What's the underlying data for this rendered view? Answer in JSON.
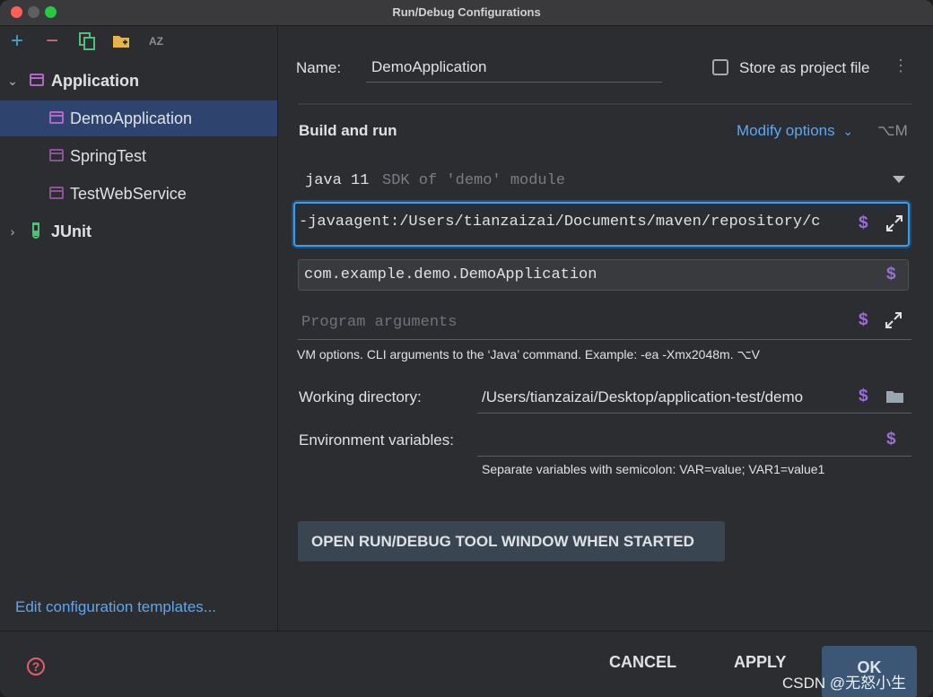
{
  "window": {
    "title": "Run/Debug Configurations"
  },
  "left": {
    "toolbar": {
      "add": "+",
      "remove": "−",
      "sort": "AZ"
    },
    "tree": [
      {
        "label": "Application",
        "expanded": true
      },
      {
        "label": "DemoApplication",
        "selected": true
      },
      {
        "label": "SpringTest"
      },
      {
        "label": "TestWebService"
      },
      {
        "label": "JUnit",
        "expanded": false
      }
    ],
    "edit_templates": "Edit configuration templates..."
  },
  "form": {
    "name_label": "Name:",
    "name_value": "DemoApplication",
    "store_label": "Store as project file",
    "build_run": "Build and run",
    "modify_options": "Modify options",
    "modify_shortcut": "⌥M",
    "sdk_java": "java 11",
    "sdk_desc": "SDK of 'demo' module",
    "vm_value": "-javaagent:/Users/tianzaizai/Documents/maven/repository/c",
    "main_class": "com.example.demo.DemoApplication",
    "program_args_placeholder": "Program arguments",
    "vm_hint": "VM options. CLI arguments to the ‘Java’ command. Example: -ea -Xmx2048m. ⌥V",
    "working_dir_label": "Working directory:",
    "working_dir_value": "/Users/tianzaizai/Desktop/application-test/demo",
    "env_label": "Environment variables:",
    "env_value": "",
    "env_hint": "Separate variables with semicolon: VAR=value; VAR1=value1",
    "tool_window_button": "OPEN RUN/DEBUG TOOL WINDOW WHEN STARTED",
    "dollar": "$"
  },
  "bottom": {
    "help": "?",
    "cancel": "CANCEL",
    "apply": "APPLY",
    "ok": "OK",
    "watermark": "CSDN @无怒小生"
  },
  "colors": {
    "accent": "#3d9be9",
    "link": "#5ea7f0",
    "selection": "#2e436e",
    "macro": "#9c6ddb"
  }
}
